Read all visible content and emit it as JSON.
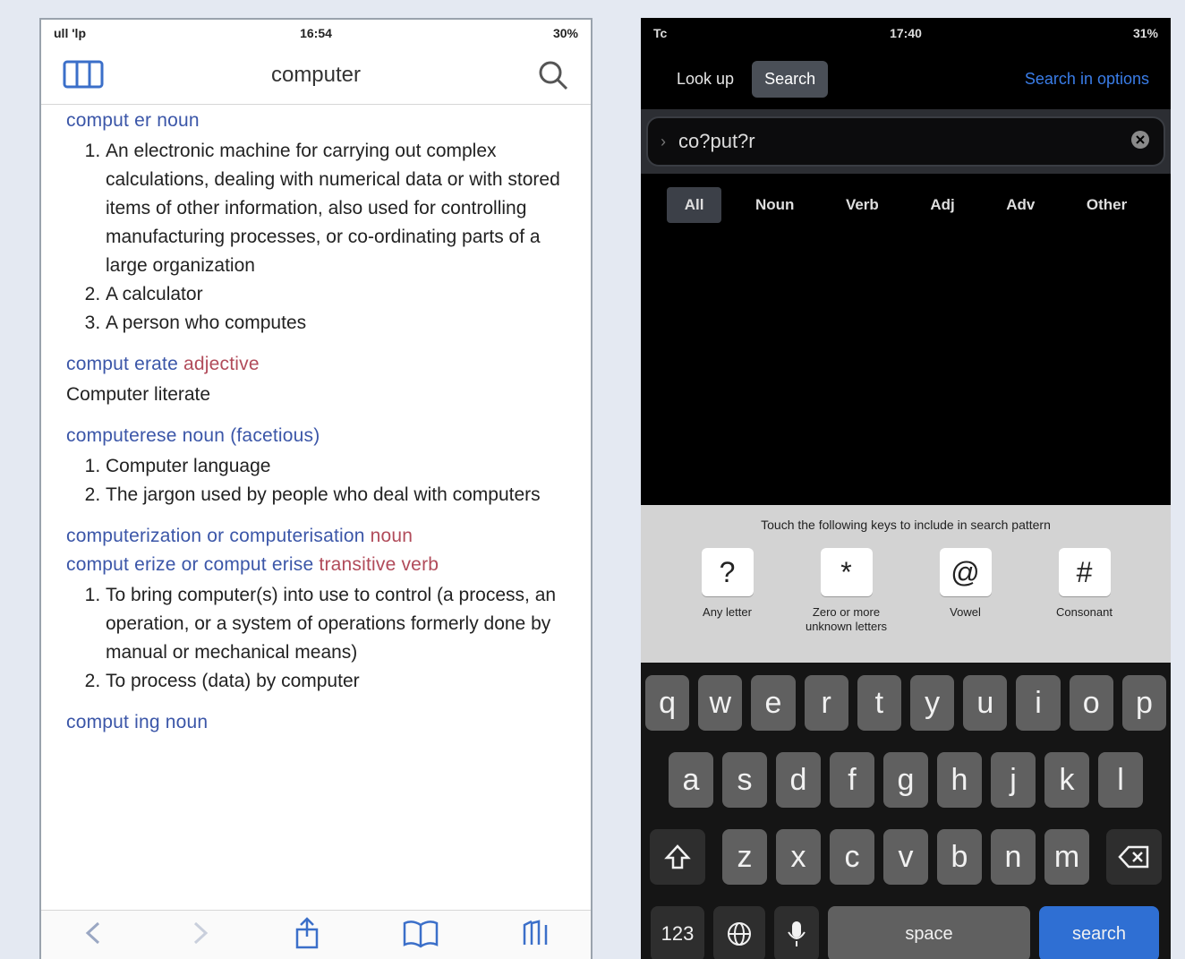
{
  "left": {
    "status": {
      "carrier": "ull 'lp",
      "time": "16:54",
      "battery": "30%"
    },
    "nav": {
      "title": "computer",
      "columns_icon": "columns-icon",
      "search_icon": "search-icon"
    },
    "entries": [
      {
        "head": "comput er",
        "pos": "noun",
        "defs": [
          "An electronic machine for carrying out complex calculations, dealing with numerical data or with stored items of other information, also used for controlling manufacturing processes, or co-ordinating parts of a large organization",
          "A calculator",
          "A person who computes"
        ]
      },
      {
        "head": "comput erate",
        "pos": "adjective",
        "sense": "Computer literate"
      },
      {
        "head": "computerese",
        "pos": "noun (facetious)",
        "defs": [
          "Computer language",
          "The jargon used by people who deal with computers"
        ]
      },
      {
        "head": "computerization or computerisation",
        "pos": "noun"
      },
      {
        "head": "comput erize or comput erise",
        "pos": "transitive verb",
        "defs": [
          "To bring computer(s) into use to control (a process, an operation, or a system of operations formerly done by manual or mechanical means)",
          "To process (data) by computer"
        ]
      },
      {
        "head": "comput ing",
        "pos": "noun"
      }
    ],
    "toolbar": [
      "back-icon",
      "forward-icon",
      "share-icon",
      "book-icon",
      "tabs-icon"
    ]
  },
  "right": {
    "status": {
      "left": "Tc",
      "time": "17:40",
      "battery": "31%"
    },
    "nav": {
      "lookup": "Look up",
      "search": "Search",
      "right_link": "Search in options"
    },
    "search_value": "co?put?r",
    "filters": [
      "All",
      "Noun",
      "Verb",
      "Adj",
      "Adv",
      "Other"
    ],
    "active_filter": "All",
    "pattern_hint": "Touch the following keys to include in search pattern",
    "pattern_keys": [
      {
        "cap": "?",
        "label": "Any letter"
      },
      {
        "cap": "*",
        "label": "Zero or more unknown letters"
      },
      {
        "cap": "@",
        "label": "Vowel"
      },
      {
        "cap": "#",
        "label": "Consonant"
      }
    ],
    "keyboard": {
      "row1": [
        "q",
        "w",
        "e",
        "r",
        "t",
        "y",
        "u",
        "i",
        "o",
        "p"
      ],
      "row2": [
        "a",
        "s",
        "d",
        "f",
        "g",
        "h",
        "j",
        "k",
        "l"
      ],
      "row3": [
        "z",
        "x",
        "c",
        "v",
        "b",
        "n",
        "m"
      ],
      "num": "123",
      "space": "space",
      "action": "search"
    }
  }
}
